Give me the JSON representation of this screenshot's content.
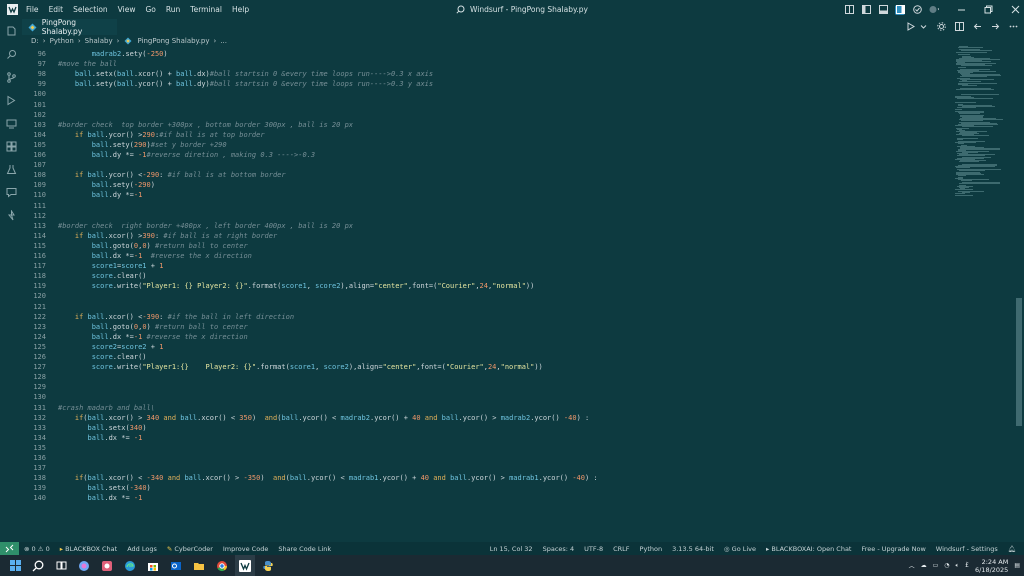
{
  "window": {
    "menu": [
      "File",
      "Edit",
      "Selection",
      "View",
      "Go",
      "Run",
      "Terminal",
      "Help"
    ],
    "command_center": "Windsurf - PingPong Shalaby.py"
  },
  "tab": {
    "label": "PingPong Shalaby.py"
  },
  "breadcrumb": [
    "D:",
    "Python",
    "Shalaby",
    "PingPong Shalaby.py",
    "..."
  ],
  "code_lines": [
    {
      "n": "96",
      "segs": [
        [
          "pl",
          "        "
        ],
        [
          "vr",
          "madrab2"
        ],
        [
          "pl",
          ".sety("
        ],
        [
          "nm",
          "-250"
        ],
        [
          "pl",
          ")"
        ]
      ]
    },
    {
      "n": "97",
      "segs": [
        [
          "cm",
          "#move the ball"
        ]
      ]
    },
    {
      "n": "98",
      "segs": [
        [
          "pl",
          "    "
        ],
        [
          "vr",
          "ball"
        ],
        [
          "pl",
          ".setx("
        ],
        [
          "vr",
          "ball"
        ],
        [
          "pl",
          ".xcor() + "
        ],
        [
          "vr",
          "ball"
        ],
        [
          "pl",
          ".dx)"
        ],
        [
          "cm",
          "#ball startsin 0 &every time loops run---->0.3 x axis"
        ]
      ]
    },
    {
      "n": "99",
      "segs": [
        [
          "pl",
          "    "
        ],
        [
          "vr",
          "ball"
        ],
        [
          "pl",
          ".sety("
        ],
        [
          "vr",
          "ball"
        ],
        [
          "pl",
          ".ycor() + "
        ],
        [
          "vr",
          "ball"
        ],
        [
          "pl",
          ".dy)"
        ],
        [
          "cm",
          "#ball startsin 0 &every time loops run---->0.3 y axis"
        ]
      ]
    },
    {
      "n": "100",
      "segs": []
    },
    {
      "n": "101",
      "segs": []
    },
    {
      "n": "102",
      "segs": []
    },
    {
      "n": "103",
      "segs": [
        [
          "cm",
          "#border check  top border +300px , bottom border 300px , ball is 20 px"
        ]
      ]
    },
    {
      "n": "104",
      "segs": [
        [
          "pl",
          "    "
        ],
        [
          "kw",
          "if "
        ],
        [
          "vr",
          "ball"
        ],
        [
          "pl",
          ".ycor() >"
        ],
        [
          "nm",
          "290"
        ],
        [
          "pl",
          ":"
        ],
        [
          "cm",
          "#if ball is at top border"
        ]
      ]
    },
    {
      "n": "105",
      "segs": [
        [
          "pl",
          "        "
        ],
        [
          "vr",
          "ball"
        ],
        [
          "pl",
          ".sety("
        ],
        [
          "nm",
          "290"
        ],
        [
          "pl",
          ")"
        ],
        [
          "cm",
          "#set y border +290"
        ]
      ]
    },
    {
      "n": "106",
      "segs": [
        [
          "pl",
          "        "
        ],
        [
          "vr",
          "ball"
        ],
        [
          "pl",
          ".dy *= "
        ],
        [
          "nm",
          "-1"
        ],
        [
          "cm",
          "#reverse diretion , making 0.3 ---->-0.3"
        ]
      ]
    },
    {
      "n": "107",
      "segs": []
    },
    {
      "n": "108",
      "segs": [
        [
          "pl",
          "    "
        ],
        [
          "kw",
          "if "
        ],
        [
          "vr",
          "ball"
        ],
        [
          "pl",
          ".ycor() <"
        ],
        [
          "nm",
          "-290"
        ],
        [
          "pl",
          ": "
        ],
        [
          "cm",
          "#if ball is at bottom border"
        ]
      ]
    },
    {
      "n": "109",
      "segs": [
        [
          "pl",
          "        "
        ],
        [
          "vr",
          "ball"
        ],
        [
          "pl",
          ".sety("
        ],
        [
          "nm",
          "-290"
        ],
        [
          "pl",
          ")"
        ]
      ]
    },
    {
      "n": "110",
      "segs": [
        [
          "pl",
          "        "
        ],
        [
          "vr",
          "ball"
        ],
        [
          "pl",
          ".dy *="
        ],
        [
          "nm",
          "-1"
        ]
      ]
    },
    {
      "n": "111",
      "segs": []
    },
    {
      "n": "112",
      "segs": []
    },
    {
      "n": "113",
      "segs": [
        [
          "cm",
          "#border check  right border +400px , left border 400px , ball is 20 px"
        ]
      ]
    },
    {
      "n": "114",
      "segs": [
        [
          "pl",
          "    "
        ],
        [
          "kw",
          "if "
        ],
        [
          "vr",
          "ball"
        ],
        [
          "pl",
          ".xcor() >"
        ],
        [
          "nm",
          "390"
        ],
        [
          "pl",
          ": "
        ],
        [
          "cm",
          "#if ball is at right border"
        ]
      ]
    },
    {
      "n": "115",
      "segs": [
        [
          "pl",
          "        "
        ],
        [
          "vr",
          "ball"
        ],
        [
          "pl",
          ".goto("
        ],
        [
          "nm",
          "0"
        ],
        [
          "pl",
          ","
        ],
        [
          "nm",
          "0"
        ],
        [
          "pl",
          ") "
        ],
        [
          "cm",
          "#return ball to center"
        ]
      ]
    },
    {
      "n": "116",
      "segs": [
        [
          "pl",
          "        "
        ],
        [
          "vr",
          "ball"
        ],
        [
          "pl",
          ".dx *="
        ],
        [
          "nm",
          "-1"
        ],
        [
          "pl",
          "  "
        ],
        [
          "cm",
          "#reverse the x direction"
        ]
      ]
    },
    {
      "n": "117",
      "segs": [
        [
          "pl",
          "        "
        ],
        [
          "vr",
          "score1"
        ],
        [
          "pl",
          "="
        ],
        [
          "vr",
          "score1"
        ],
        [
          "pl",
          " + "
        ],
        [
          "nm",
          "1"
        ]
      ]
    },
    {
      "n": "118",
      "segs": [
        [
          "pl",
          "        "
        ],
        [
          "vr",
          "score"
        ],
        [
          "pl",
          ".clear()"
        ]
      ]
    },
    {
      "n": "119",
      "segs": [
        [
          "pl",
          "        "
        ],
        [
          "vr",
          "score"
        ],
        [
          "pl",
          ".write("
        ],
        [
          "st",
          "\"Player1: {} Player2: {}\""
        ],
        [
          "pl",
          ".format("
        ],
        [
          "vr",
          "score1"
        ],
        [
          "pl",
          ", "
        ],
        [
          "vr",
          "score2"
        ],
        [
          "pl",
          "),align="
        ],
        [
          "st",
          "\"center\""
        ],
        [
          "pl",
          ",font=("
        ],
        [
          "st",
          "\"Courier\""
        ],
        [
          "pl",
          ","
        ],
        [
          "nm",
          "24"
        ],
        [
          "pl",
          ","
        ],
        [
          "st",
          "\"normal\""
        ],
        [
          "pl",
          "))"
        ]
      ]
    },
    {
      "n": "120",
      "segs": []
    },
    {
      "n": "121",
      "segs": []
    },
    {
      "n": "122",
      "segs": [
        [
          "pl",
          "    "
        ],
        [
          "kw",
          "if "
        ],
        [
          "vr",
          "ball"
        ],
        [
          "pl",
          ".xcor() <"
        ],
        [
          "nm",
          "-390"
        ],
        [
          "pl",
          ": "
        ],
        [
          "cm",
          "#if the ball in left direction"
        ]
      ]
    },
    {
      "n": "123",
      "segs": [
        [
          "pl",
          "        "
        ],
        [
          "vr",
          "ball"
        ],
        [
          "pl",
          ".goto("
        ],
        [
          "nm",
          "0"
        ],
        [
          "pl",
          ","
        ],
        [
          "nm",
          "0"
        ],
        [
          "pl",
          ") "
        ],
        [
          "cm",
          "#return ball to center"
        ]
      ]
    },
    {
      "n": "124",
      "segs": [
        [
          "pl",
          "        "
        ],
        [
          "vr",
          "ball"
        ],
        [
          "pl",
          ".dx *="
        ],
        [
          "nm",
          "-1"
        ],
        [
          "pl",
          " "
        ],
        [
          "cm",
          "#reverse the x direction"
        ]
      ]
    },
    {
      "n": "125",
      "segs": [
        [
          "pl",
          "        "
        ],
        [
          "vr",
          "score2"
        ],
        [
          "pl",
          "="
        ],
        [
          "vr",
          "score2"
        ],
        [
          "pl",
          " + "
        ],
        [
          "nm",
          "1"
        ]
      ]
    },
    {
      "n": "126",
      "segs": [
        [
          "pl",
          "        "
        ],
        [
          "vr",
          "score"
        ],
        [
          "pl",
          ".clear()"
        ]
      ]
    },
    {
      "n": "127",
      "segs": [
        [
          "pl",
          "        "
        ],
        [
          "vr",
          "score"
        ],
        [
          "pl",
          ".write("
        ],
        [
          "st",
          "\"Player1:{}    Player2: {}\""
        ],
        [
          "pl",
          ".format("
        ],
        [
          "vr",
          "score1"
        ],
        [
          "pl",
          ", "
        ],
        [
          "vr",
          "score2"
        ],
        [
          "pl",
          "),align="
        ],
        [
          "st",
          "\"center\""
        ],
        [
          "pl",
          ",font=("
        ],
        [
          "st",
          "\"Courier\""
        ],
        [
          "pl",
          ","
        ],
        [
          "nm",
          "24"
        ],
        [
          "pl",
          ","
        ],
        [
          "st",
          "\"normal\""
        ],
        [
          "pl",
          "))"
        ]
      ]
    },
    {
      "n": "128",
      "segs": []
    },
    {
      "n": "129",
      "segs": []
    },
    {
      "n": "130",
      "segs": []
    },
    {
      "n": "131",
      "segs": [
        [
          "cm",
          "#crash madarb and ball\\"
        ]
      ]
    },
    {
      "n": "132",
      "segs": [
        [
          "pl",
          "    "
        ],
        [
          "kw",
          "if"
        ],
        [
          "pl",
          "("
        ],
        [
          "vr",
          "ball"
        ],
        [
          "pl",
          ".xcor() > "
        ],
        [
          "nm",
          "340"
        ],
        [
          "kw",
          " and "
        ],
        [
          "vr",
          "ball"
        ],
        [
          "pl",
          ".xcor() < "
        ],
        [
          "nm",
          "350"
        ],
        [
          "pl",
          ")  "
        ],
        [
          "kw",
          "and"
        ],
        [
          "pl",
          "("
        ],
        [
          "vr",
          "ball"
        ],
        [
          "pl",
          ".ycor() < "
        ],
        [
          "vr",
          "madrab2"
        ],
        [
          "pl",
          ".ycor() + "
        ],
        [
          "nm",
          "40"
        ],
        [
          "kw",
          " and "
        ],
        [
          "vr",
          "ball"
        ],
        [
          "pl",
          ".ycor() > "
        ],
        [
          "vr",
          "madrab2"
        ],
        [
          "pl",
          ".ycor() "
        ],
        [
          "nm",
          "-40"
        ],
        [
          "pl",
          ") :"
        ]
      ]
    },
    {
      "n": "133",
      "segs": [
        [
          "pl",
          "       "
        ],
        [
          "vr",
          "ball"
        ],
        [
          "pl",
          ".setx("
        ],
        [
          "nm",
          "340"
        ],
        [
          "pl",
          ")"
        ]
      ]
    },
    {
      "n": "134",
      "segs": [
        [
          "pl",
          "       "
        ],
        [
          "vr",
          "ball"
        ],
        [
          "pl",
          ".dx *= "
        ],
        [
          "nm",
          "-1"
        ]
      ]
    },
    {
      "n": "135",
      "segs": []
    },
    {
      "n": "136",
      "segs": []
    },
    {
      "n": "137",
      "segs": []
    },
    {
      "n": "138",
      "segs": [
        [
          "pl",
          "    "
        ],
        [
          "kw",
          "if"
        ],
        [
          "pl",
          "("
        ],
        [
          "vr",
          "ball"
        ],
        [
          "pl",
          ".xcor() < "
        ],
        [
          "nm",
          "-340"
        ],
        [
          "kw",
          " and "
        ],
        [
          "vr",
          "ball"
        ],
        [
          "pl",
          ".xcor() > "
        ],
        [
          "nm",
          "-350"
        ],
        [
          "pl",
          ")  "
        ],
        [
          "kw",
          "and"
        ],
        [
          "pl",
          "("
        ],
        [
          "vr",
          "ball"
        ],
        [
          "pl",
          ".ycor() < "
        ],
        [
          "vr",
          "madrab1"
        ],
        [
          "pl",
          ".ycor() + "
        ],
        [
          "nm",
          "40"
        ],
        [
          "kw",
          " and "
        ],
        [
          "vr",
          "ball"
        ],
        [
          "pl",
          ".ycor() > "
        ],
        [
          "vr",
          "madrab1"
        ],
        [
          "pl",
          ".ycor() "
        ],
        [
          "nm",
          "-40"
        ],
        [
          "pl",
          ") :"
        ]
      ]
    },
    {
      "n": "139",
      "segs": [
        [
          "pl",
          "       "
        ],
        [
          "vr",
          "ball"
        ],
        [
          "pl",
          ".setx("
        ],
        [
          "nm",
          "-340"
        ],
        [
          "pl",
          ")"
        ]
      ]
    },
    {
      "n": "140",
      "segs": [
        [
          "pl",
          "       "
        ],
        [
          "vr",
          "ball"
        ],
        [
          "pl",
          ".dx *= "
        ],
        [
          "nm",
          "-1"
        ]
      ]
    }
  ],
  "status": {
    "problems": "⊗ 0 ⚠ 0",
    "left": [
      "BLACKBOX Chat",
      "Add Logs",
      "CyberCoder",
      "Improve Code",
      "Share Code Link"
    ],
    "right": [
      "Ln 15, Col 32",
      "Spaces: 4",
      "UTF-8",
      "CRLF",
      "Python",
      "3.13.5 64-bit",
      "Go Live",
      "BLACKBOXAI: Open Chat",
      "Free - Upgrade Now",
      "Windsurf - Settings"
    ]
  },
  "taskbar": {
    "time": "2:24 AM",
    "date": "6/18/2025"
  }
}
